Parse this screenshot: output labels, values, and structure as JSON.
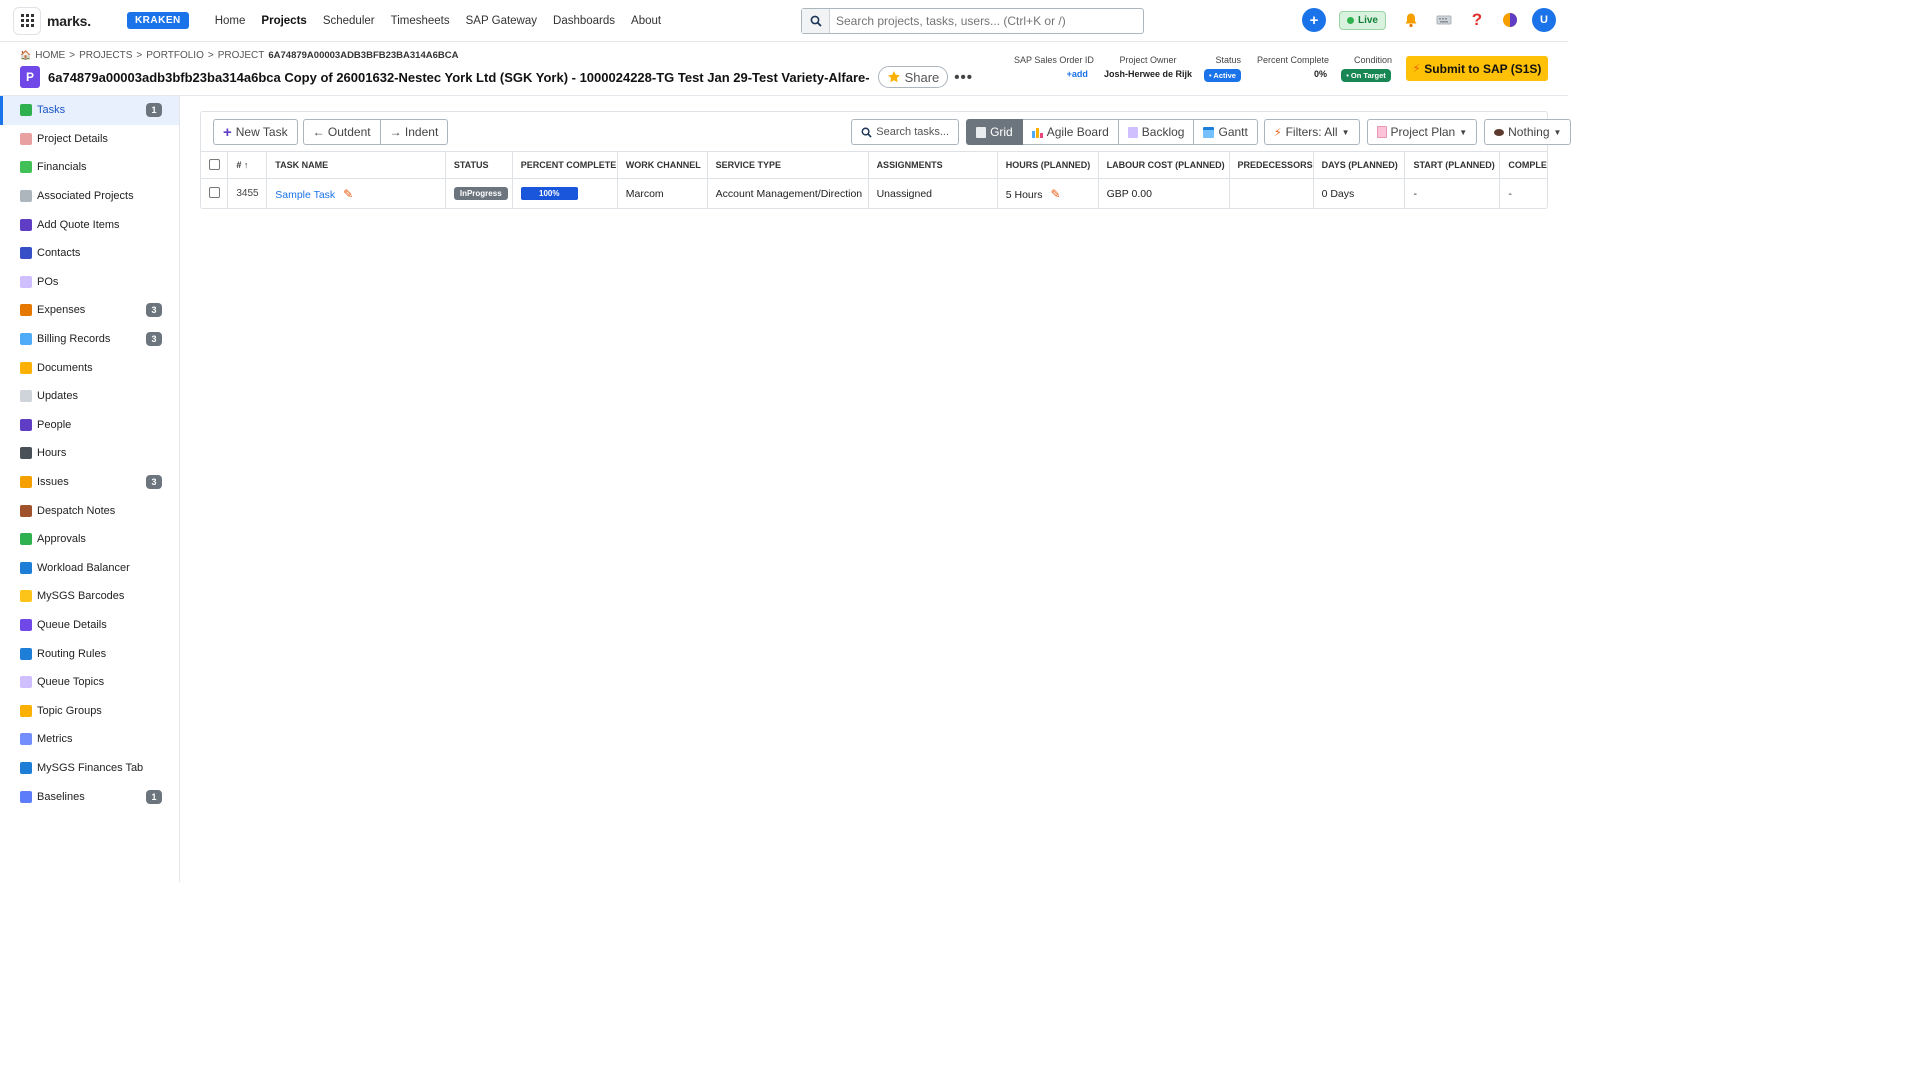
{
  "nav": {
    "logo": "marks.",
    "env_badge": "KRAKEN",
    "links": [
      "Home",
      "Projects",
      "Scheduler",
      "Timesheets",
      "SAP Gateway",
      "Dashboards",
      "About"
    ],
    "active_link": "Projects",
    "search_placeholder": "Search projects, tasks, users... (Ctrl+K or /)",
    "live_label": "Live",
    "plus_label": "+",
    "avatar_initial": "U"
  },
  "header": {
    "breadcrumb": [
      "HOME",
      "PROJECTS",
      "PORTFOLIO",
      "PROJECT",
      "6A74879A00003ADB3BFB23BA314A6BCA"
    ],
    "project_letter": "P",
    "title": "6a74879a00003adb3bfb23ba314a6bca Copy of 26001632-Nestec York Ltd (SGK York) - 1000024228-TG Test Jan 29-Test Variety-Alfare-",
    "share_label": "Share",
    "more_label": "•••",
    "meta": {
      "sap_label": "SAP Sales Order ID",
      "sap_value": "+add",
      "owner_label": "Project Owner",
      "owner_value": "Josh-Herwee de Rijk",
      "status_label": "Status",
      "status_value": "• Active",
      "percent_label": "Percent Complete",
      "percent_value": "0%",
      "condition_label": "Condition",
      "condition_value": "• On Target"
    },
    "submit_label": "Submit to SAP (S1S)"
  },
  "sidebar": {
    "items": [
      {
        "label": "Tasks",
        "icon": "check-icon",
        "color": "#2fb14f",
        "badge": "1",
        "active": true
      },
      {
        "label": "Project Details",
        "icon": "document-icon",
        "color": "#e9a0a0",
        "badge": ""
      },
      {
        "label": "Financials",
        "icon": "chart-icon",
        "color": "#40c057",
        "badge": ""
      },
      {
        "label": "Associated Projects",
        "icon": "link-icon",
        "color": "#adb5bd",
        "badge": ""
      },
      {
        "label": "Add Quote Items",
        "icon": "plus-icon",
        "color": "#5f3dc4",
        "badge": ""
      },
      {
        "label": "Contacts",
        "icon": "people-icon",
        "color": "#364fc7",
        "badge": ""
      },
      {
        "label": "POs",
        "icon": "page-icon",
        "color": "#d0bfff",
        "badge": ""
      },
      {
        "label": "Expenses",
        "icon": "money-bag-icon",
        "color": "#e67700",
        "badge": "3"
      },
      {
        "label": "Billing Records",
        "icon": "bar-chart-icon",
        "color": "#4dabf7",
        "badge": "3"
      },
      {
        "label": "Documents",
        "icon": "folder-icon",
        "color": "#fab005",
        "badge": ""
      },
      {
        "label": "Updates",
        "icon": "speech-icon",
        "color": "#ced4da",
        "badge": ""
      },
      {
        "label": "People",
        "icon": "person-icon",
        "color": "#5f3dc4",
        "badge": ""
      },
      {
        "label": "Hours",
        "icon": "stopwatch-icon",
        "color": "#495057",
        "badge": ""
      },
      {
        "label": "Issues",
        "icon": "warning-icon",
        "color": "#f59f00",
        "badge": "3"
      },
      {
        "label": "Despatch Notes",
        "icon": "package-icon",
        "color": "#a0522d",
        "badge": ""
      },
      {
        "label": "Approvals",
        "icon": "check-icon",
        "color": "#2fb14f",
        "badge": ""
      },
      {
        "label": "Workload Balancer",
        "icon": "calendar-icon",
        "color": "#1c7ed6",
        "badge": ""
      },
      {
        "label": "MySGS Barcodes",
        "icon": "tag-icon",
        "color": "#fcc419",
        "badge": ""
      },
      {
        "label": "Queue Details",
        "icon": "queue-icon",
        "color": "#7048e8",
        "badge": ""
      },
      {
        "label": "Routing Rules",
        "icon": "routing-icon",
        "color": "#1c7ed6",
        "badge": ""
      },
      {
        "label": "Queue Topics",
        "icon": "page-icon",
        "color": "#d0bfff",
        "badge": ""
      },
      {
        "label": "Topic Groups",
        "icon": "folder-icon",
        "color": "#fab005",
        "badge": ""
      },
      {
        "label": "Metrics",
        "icon": "line-chart-icon",
        "color": "#748ffc",
        "badge": ""
      },
      {
        "label": "MySGS Finances Tab",
        "icon": "card-icon",
        "color": "#1c7ed6",
        "badge": ""
      },
      {
        "label": "Baselines",
        "icon": "ruler-icon",
        "color": "#5c7cfa",
        "badge": "1"
      }
    ]
  },
  "toolbar": {
    "new_task": "New Task",
    "outdent": "← Outdent",
    "indent": "→ Indent",
    "search_placeholder": "Search tasks...",
    "views": [
      "Grid",
      "Agile Board",
      "Backlog",
      "Gantt"
    ],
    "active_view": "Grid",
    "filters": "Filters: All",
    "project_plan": "Project Plan",
    "nothing": "Nothing"
  },
  "table": {
    "columns": [
      "# ↑",
      "TASK NAME",
      "STATUS",
      "PERCENT COMPLETE",
      "WORK CHANNEL",
      "SERVICE TYPE",
      "ASSIGNMENTS",
      "HOURS (PLANNED)",
      "LABOUR COST (PLANNED)",
      "PREDECESSORS",
      "DAYS (PLANNED)",
      "START (PLANNED)",
      "COMPLE"
    ],
    "rows": [
      {
        "id": "3455",
        "task_name": "Sample Task",
        "status": "InProgress",
        "percent": "100%",
        "percent_value": 1.0,
        "work_channel": "Marcom",
        "service_type": "Account Management/Direction",
        "assignments": "Unassigned",
        "hours": "5 Hours",
        "labour_cost": "GBP 0.00",
        "predecessors": "",
        "days": "0 Days",
        "start": "-",
        "complete": "-"
      }
    ]
  },
  "colors": {
    "primary": "#1a73e8",
    "submit": "#ffc107",
    "status_grey": "#6c757d",
    "on_target": "#198754"
  }
}
